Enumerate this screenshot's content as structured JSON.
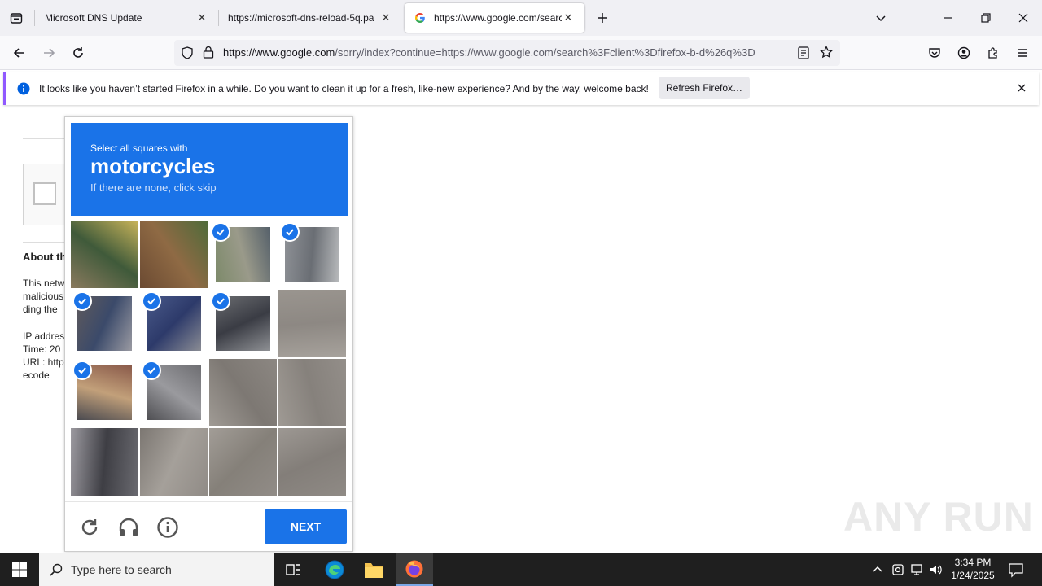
{
  "browser": {
    "tabs": [
      {
        "title": "Microsoft DNS Update",
        "active": false
      },
      {
        "title": "https://microsoft-dns-reload-5q.pa",
        "active": false
      },
      {
        "title": "https://www.google.com/search",
        "active": true
      }
    ],
    "url_host": "https://www.google.com",
    "url_path": "/sorry/index?continue=https://www.google.com/search%3Fclient%3Dfirefox-b-d%26q%3D",
    "notification_text": "It looks like you haven’t started Firefox in a while. Do you want to clean it up for a fresh, like-new experience? And by the way, welcome back!",
    "refresh_label": "Refresh Firefox…"
  },
  "page": {
    "about_heading": "About th",
    "lines": [
      "This netw",
      "malicious",
      "ding the",
      "IP addres",
      "Time: 20",
      "URL: http",
      "ecode"
    ]
  },
  "captcha": {
    "instruction": "Select all squares with",
    "target": "motorcycles",
    "hint": "If there are none, click skip",
    "next_label": "NEXT",
    "grid": [
      [
        false,
        false,
        true,
        true
      ],
      [
        true,
        true,
        true,
        false
      ],
      [
        true,
        true,
        false,
        false
      ],
      [
        false,
        false,
        false,
        false
      ]
    ]
  },
  "taskbar": {
    "search_placeholder": "Type here to search",
    "time": "3:34 PM",
    "date": "1/24/2025"
  },
  "watermark": "ANY RUN",
  "colors": {
    "accent": "#1a73e8",
    "notif_border": "#9059ff"
  }
}
